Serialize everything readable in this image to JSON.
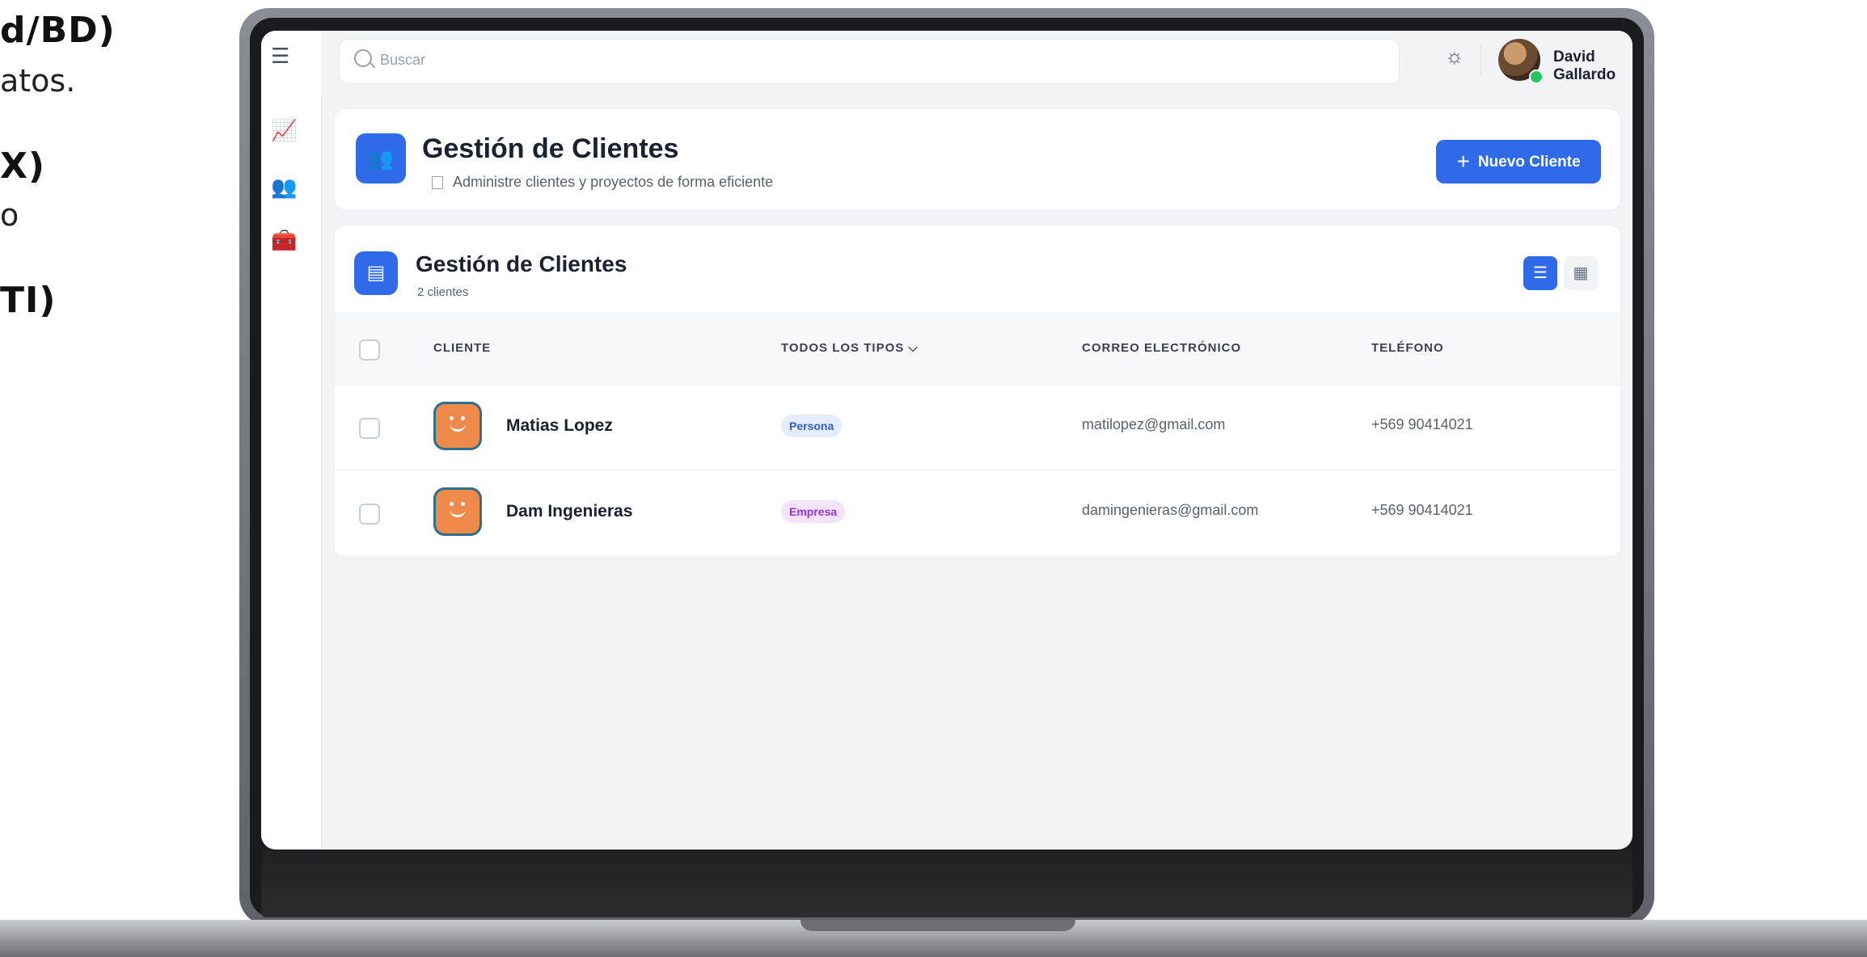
{
  "left_panel": {
    "lines": [
      "d/BD)",
      "atos.",
      "X)",
      "o",
      "TI)"
    ]
  },
  "topbar": {
    "search_placeholder": "Buscar",
    "user_name": "David Gallardo"
  },
  "header_card": {
    "title": "Gestión de Clientes",
    "subtitle": "Administre clientes y proyectos de forma eficiente",
    "new_button": "Nuevo Cliente"
  },
  "list_card": {
    "title": "Gestión de Clientes",
    "count": "2 clientes",
    "columns": [
      "CLIENTE",
      "TODOS LOS TIPOS ⌵",
      "CORREO ELECTRÓNICO",
      "TELÉFONO"
    ],
    "rows": [
      {
        "name": "Matias Lopez",
        "type": "Persona",
        "email": "matilopez@gmail.com",
        "phone": "+569 90414021"
      },
      {
        "name": "Dam Ingenieras",
        "type": "Empresa",
        "email": "damingenieras@gmail.com",
        "phone": "+569 90414021"
      }
    ]
  },
  "icons": {
    "menu": "menu-icon",
    "chart": "chart-icon",
    "users": "users-icon",
    "projects": "projects-icon",
    "theme": "sun-icon"
  },
  "colors": {
    "accent": "#2f6be8",
    "online": "#22c55e",
    "persona_tag": "#e4ecff",
    "empresa_tag": "#f3e3ff"
  }
}
